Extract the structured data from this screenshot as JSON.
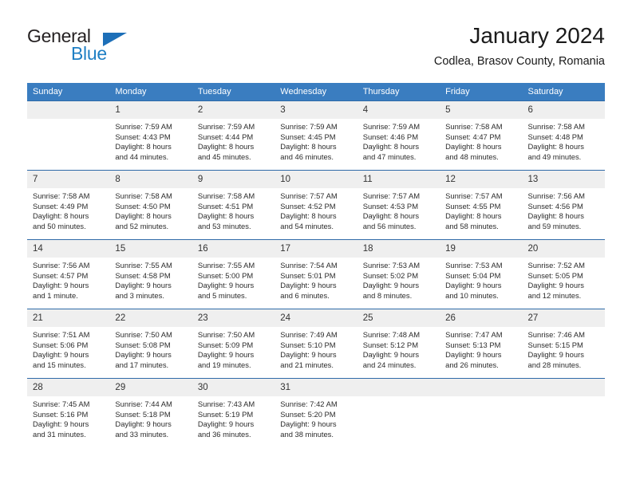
{
  "brand": {
    "name_top": "General",
    "name_bottom": "Blue",
    "accent_color": "#1d6fb8"
  },
  "header": {
    "title": "January 2024",
    "subtitle": "Codlea, Brasov County, Romania"
  },
  "calendar": {
    "header_bg": "#3a7dc0",
    "header_text_color": "#ffffff",
    "daynum_bg": "#efefef",
    "row_border_color": "#2f6aa8",
    "weekdays": [
      "Sunday",
      "Monday",
      "Tuesday",
      "Wednesday",
      "Thursday",
      "Friday",
      "Saturday"
    ],
    "weeks": [
      [
        {
          "day": "",
          "lines": []
        },
        {
          "day": "1",
          "lines": [
            "Sunrise: 7:59 AM",
            "Sunset: 4:43 PM",
            "Daylight: 8 hours",
            "and 44 minutes."
          ]
        },
        {
          "day": "2",
          "lines": [
            "Sunrise: 7:59 AM",
            "Sunset: 4:44 PM",
            "Daylight: 8 hours",
            "and 45 minutes."
          ]
        },
        {
          "day": "3",
          "lines": [
            "Sunrise: 7:59 AM",
            "Sunset: 4:45 PM",
            "Daylight: 8 hours",
            "and 46 minutes."
          ]
        },
        {
          "day": "4",
          "lines": [
            "Sunrise: 7:59 AM",
            "Sunset: 4:46 PM",
            "Daylight: 8 hours",
            "and 47 minutes."
          ]
        },
        {
          "day": "5",
          "lines": [
            "Sunrise: 7:58 AM",
            "Sunset: 4:47 PM",
            "Daylight: 8 hours",
            "and 48 minutes."
          ]
        },
        {
          "day": "6",
          "lines": [
            "Sunrise: 7:58 AM",
            "Sunset: 4:48 PM",
            "Daylight: 8 hours",
            "and 49 minutes."
          ]
        }
      ],
      [
        {
          "day": "7",
          "lines": [
            "Sunrise: 7:58 AM",
            "Sunset: 4:49 PM",
            "Daylight: 8 hours",
            "and 50 minutes."
          ]
        },
        {
          "day": "8",
          "lines": [
            "Sunrise: 7:58 AM",
            "Sunset: 4:50 PM",
            "Daylight: 8 hours",
            "and 52 minutes."
          ]
        },
        {
          "day": "9",
          "lines": [
            "Sunrise: 7:58 AM",
            "Sunset: 4:51 PM",
            "Daylight: 8 hours",
            "and 53 minutes."
          ]
        },
        {
          "day": "10",
          "lines": [
            "Sunrise: 7:57 AM",
            "Sunset: 4:52 PM",
            "Daylight: 8 hours",
            "and 54 minutes."
          ]
        },
        {
          "day": "11",
          "lines": [
            "Sunrise: 7:57 AM",
            "Sunset: 4:53 PM",
            "Daylight: 8 hours",
            "and 56 minutes."
          ]
        },
        {
          "day": "12",
          "lines": [
            "Sunrise: 7:57 AM",
            "Sunset: 4:55 PM",
            "Daylight: 8 hours",
            "and 58 minutes."
          ]
        },
        {
          "day": "13",
          "lines": [
            "Sunrise: 7:56 AM",
            "Sunset: 4:56 PM",
            "Daylight: 8 hours",
            "and 59 minutes."
          ]
        }
      ],
      [
        {
          "day": "14",
          "lines": [
            "Sunrise: 7:56 AM",
            "Sunset: 4:57 PM",
            "Daylight: 9 hours",
            "and 1 minute."
          ]
        },
        {
          "day": "15",
          "lines": [
            "Sunrise: 7:55 AM",
            "Sunset: 4:58 PM",
            "Daylight: 9 hours",
            "and 3 minutes."
          ]
        },
        {
          "day": "16",
          "lines": [
            "Sunrise: 7:55 AM",
            "Sunset: 5:00 PM",
            "Daylight: 9 hours",
            "and 5 minutes."
          ]
        },
        {
          "day": "17",
          "lines": [
            "Sunrise: 7:54 AM",
            "Sunset: 5:01 PM",
            "Daylight: 9 hours",
            "and 6 minutes."
          ]
        },
        {
          "day": "18",
          "lines": [
            "Sunrise: 7:53 AM",
            "Sunset: 5:02 PM",
            "Daylight: 9 hours",
            "and 8 minutes."
          ]
        },
        {
          "day": "19",
          "lines": [
            "Sunrise: 7:53 AM",
            "Sunset: 5:04 PM",
            "Daylight: 9 hours",
            "and 10 minutes."
          ]
        },
        {
          "day": "20",
          "lines": [
            "Sunrise: 7:52 AM",
            "Sunset: 5:05 PM",
            "Daylight: 9 hours",
            "and 12 minutes."
          ]
        }
      ],
      [
        {
          "day": "21",
          "lines": [
            "Sunrise: 7:51 AM",
            "Sunset: 5:06 PM",
            "Daylight: 9 hours",
            "and 15 minutes."
          ]
        },
        {
          "day": "22",
          "lines": [
            "Sunrise: 7:50 AM",
            "Sunset: 5:08 PM",
            "Daylight: 9 hours",
            "and 17 minutes."
          ]
        },
        {
          "day": "23",
          "lines": [
            "Sunrise: 7:50 AM",
            "Sunset: 5:09 PM",
            "Daylight: 9 hours",
            "and 19 minutes."
          ]
        },
        {
          "day": "24",
          "lines": [
            "Sunrise: 7:49 AM",
            "Sunset: 5:10 PM",
            "Daylight: 9 hours",
            "and 21 minutes."
          ]
        },
        {
          "day": "25",
          "lines": [
            "Sunrise: 7:48 AM",
            "Sunset: 5:12 PM",
            "Daylight: 9 hours",
            "and 24 minutes."
          ]
        },
        {
          "day": "26",
          "lines": [
            "Sunrise: 7:47 AM",
            "Sunset: 5:13 PM",
            "Daylight: 9 hours",
            "and 26 minutes."
          ]
        },
        {
          "day": "27",
          "lines": [
            "Sunrise: 7:46 AM",
            "Sunset: 5:15 PM",
            "Daylight: 9 hours",
            "and 28 minutes."
          ]
        }
      ],
      [
        {
          "day": "28",
          "lines": [
            "Sunrise: 7:45 AM",
            "Sunset: 5:16 PM",
            "Daylight: 9 hours",
            "and 31 minutes."
          ]
        },
        {
          "day": "29",
          "lines": [
            "Sunrise: 7:44 AM",
            "Sunset: 5:18 PM",
            "Daylight: 9 hours",
            "and 33 minutes."
          ]
        },
        {
          "day": "30",
          "lines": [
            "Sunrise: 7:43 AM",
            "Sunset: 5:19 PM",
            "Daylight: 9 hours",
            "and 36 minutes."
          ]
        },
        {
          "day": "31",
          "lines": [
            "Sunrise: 7:42 AM",
            "Sunset: 5:20 PM",
            "Daylight: 9 hours",
            "and 38 minutes."
          ]
        },
        {
          "day": "",
          "lines": []
        },
        {
          "day": "",
          "lines": []
        },
        {
          "day": "",
          "lines": []
        }
      ]
    ]
  }
}
